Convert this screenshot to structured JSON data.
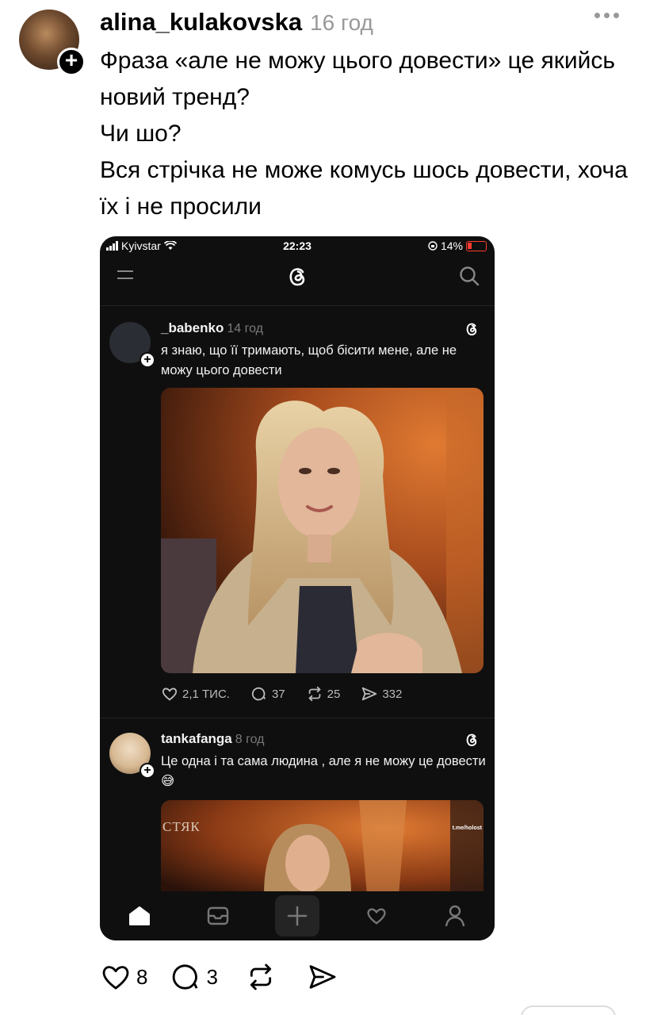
{
  "post": {
    "username": "alina_kulakovska",
    "time": "16 год",
    "paragraphs": [
      "Фраза «але не можу цього довести» це якийсь новий тренд?",
      "Чи шо?",
      "Вся стрічка не може комусь шось довести, хоча їх і не просили"
    ],
    "likes": "8",
    "replies": "3"
  },
  "screenshot": {
    "statusbar": {
      "carrier": "Kyivstar",
      "time": "22:23",
      "battery": "14%"
    },
    "threads": [
      {
        "username": "_babenko",
        "time": "14 год",
        "text": "я знаю, що її тримають, щоб бісити мене, але не можу цього довести",
        "likes": "2,1 ТИС.",
        "replies": "37",
        "reposts": "25",
        "shares": "332"
      },
      {
        "username": "tankafanga",
        "time": "8 год",
        "text": "Це одна і та сама людина , але я не можу це довести 😅",
        "image_caption": "СТЯК",
        "image_watermark": "t.me/holost"
      }
    ]
  },
  "colors": {
    "accent": "#000000",
    "muted": "#999999",
    "phone_bg": "#0f0f0f"
  },
  "icons": [
    "heart-icon",
    "reply-icon",
    "repost-icon",
    "share-icon",
    "threads-logo-icon",
    "search-icon",
    "menu-icon",
    "home-icon",
    "inbox-icon",
    "plus-icon",
    "profile-icon"
  ]
}
